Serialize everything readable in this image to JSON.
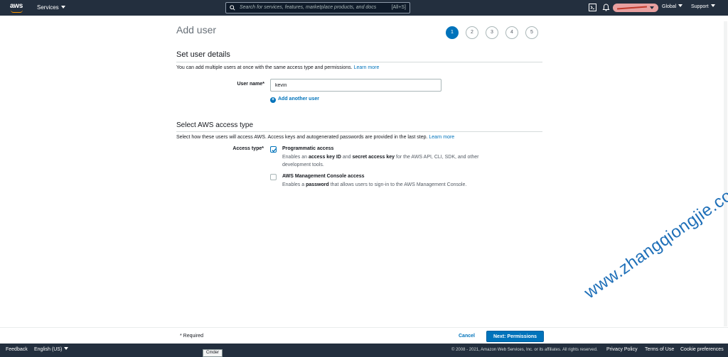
{
  "topnav": {
    "services_label": "Services",
    "search_placeholder": "Search for services, features, marketplace products, and docs",
    "search_shortcut": "[All+S]",
    "region_label": "Global",
    "support_label": "Support"
  },
  "wizard": {
    "title": "Add user",
    "steps": [
      "1",
      "2",
      "3",
      "4",
      "5"
    ],
    "active_step": 1
  },
  "user_details": {
    "heading": "Set user details",
    "description": "You can add multiple users at once with the same access type and permissions.",
    "learn_more": "Learn more",
    "username_label": "User name*",
    "username_value": "kevin",
    "add_another_user": "Add another user"
  },
  "access_type": {
    "heading": "Select AWS access type",
    "description": "Select how these users will access AWS. Access keys and autogenerated passwords are provided in the last step.",
    "learn_more": "Learn more",
    "label": "Access type*",
    "options": [
      {
        "title": "Programmatic access",
        "checked": true,
        "desc_pre": "Enables an ",
        "desc_b1": "access key ID",
        "desc_mid": " and ",
        "desc_b2": "secret access key",
        "desc_post": " for the AWS API, CLI, SDK, and other development tools."
      },
      {
        "title": "AWS Management Console access",
        "checked": false,
        "desc_pre": "Enables a ",
        "desc_b1": "password",
        "desc_post": " that allows users to sign-in to the AWS Management Console."
      }
    ]
  },
  "actions": {
    "required_note": "* Required",
    "cancel": "Cancel",
    "next": "Next: Permissions"
  },
  "footer": {
    "feedback": "Feedback",
    "language": "English (US)",
    "copyright": "© 2008 - 2021, Amazon Web Services, Inc. or its affiliates. All rights reserved.",
    "privacy": "Privacy Policy",
    "terms": "Terms of Use",
    "cookies": "Cookie preferences"
  },
  "taskbar_tooltip": "Cmder",
  "watermark": "www.zhangqiongjie.com",
  "colors": {
    "nav_bg": "#232f3e",
    "accent": "#0073bb",
    "aws_orange": "#ff9900"
  }
}
